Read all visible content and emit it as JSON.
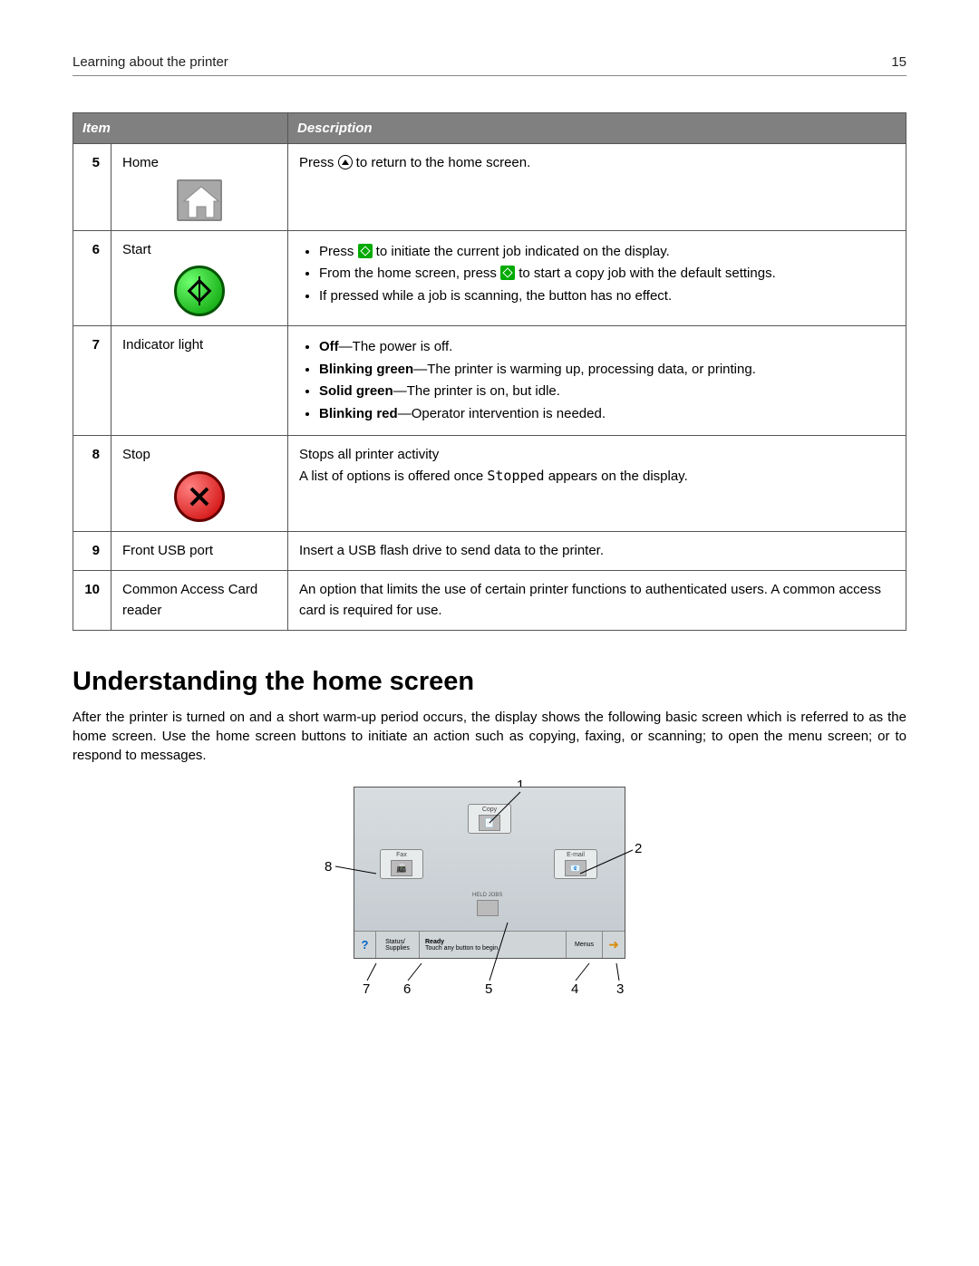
{
  "header": {
    "title": "Learning about the printer",
    "page_number": "15"
  },
  "table": {
    "headers": {
      "item": "Item",
      "description": "Description"
    },
    "rows": [
      {
        "num": "5",
        "name": "Home",
        "desc_type": "home",
        "desc_prefix": "Press ",
        "desc_suffix": " to return to the home screen."
      },
      {
        "num": "6",
        "name": "Start",
        "desc_type": "start",
        "bullets": [
          {
            "prefix": "Press ",
            "icon": true,
            "suffix": " to initiate the current job indicated on the display."
          },
          {
            "prefix": "From the home screen, press ",
            "icon": true,
            "suffix": " to start a copy job with the default settings."
          },
          {
            "prefix": "If pressed while a job is scanning, the button has no effect.",
            "icon": false,
            "suffix": ""
          }
        ]
      },
      {
        "num": "7",
        "name": "Indicator light",
        "desc_type": "indicator",
        "bullets": [
          {
            "bold": "Off",
            "rest": "—The power is off."
          },
          {
            "bold": "Blinking green",
            "rest": "—The printer is warming up, processing data, or printing."
          },
          {
            "bold": "Solid green",
            "rest": "—The printer is on, but idle."
          },
          {
            "bold": "Blinking red",
            "rest": "—Operator intervention is needed."
          }
        ]
      },
      {
        "num": "8",
        "name": "Stop",
        "desc_type": "stop",
        "line1": "Stops all printer activity",
        "line2_a": "A list of options is offered once ",
        "line2_code": "Stopped",
        "line2_b": " appears on the display."
      },
      {
        "num": "9",
        "name": "Front USB port",
        "desc_type": "plain",
        "text": "Insert a USB flash drive to send data to the printer."
      },
      {
        "num": "10",
        "name": "Common Access Card reader",
        "desc_type": "plain",
        "text": "An option that limits the use of certain printer functions to authenticated users. A common access card is required for use."
      }
    ]
  },
  "section": {
    "heading": "Understanding the home screen",
    "body": "After the printer is turned on and a short warm-up period occurs, the display shows the following basic screen which is referred to as the home screen. Use the home screen buttons to initiate an action such as copying, faxing, or scanning; to open the menu screen; or to respond to messages."
  },
  "homescreen": {
    "copy": "Copy",
    "fax": "Fax",
    "email": "E-mail",
    "held_jobs": "HELD JOBS",
    "ready": "Ready",
    "touch": "Touch any button to begin.",
    "status_supplies": "Status/\nSupplies",
    "menus": "Menus",
    "callouts": [
      "1",
      "2",
      "3",
      "4",
      "5",
      "6",
      "7",
      "8"
    ]
  }
}
